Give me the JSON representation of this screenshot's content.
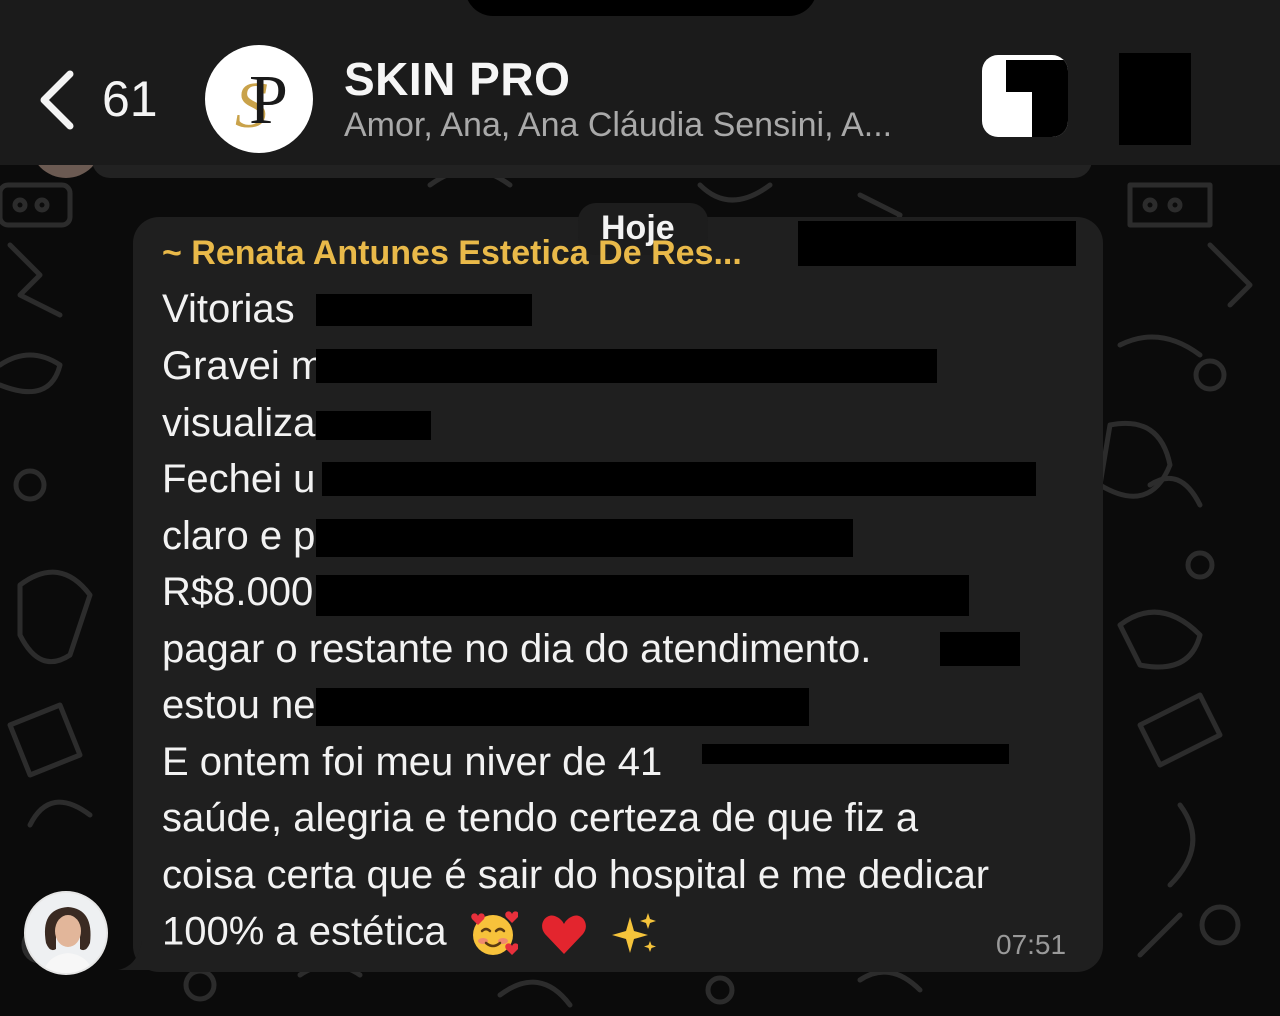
{
  "header": {
    "back_count": "61",
    "title": "SKIN PRO",
    "subtitle": "Amor, Ana, Ana Cláudia Sensini, A..."
  },
  "chat": {
    "date_label": "Hoje",
    "message": {
      "sender": "~ Renata Antunes Estetica De Res...",
      "lines": [
        "Vitorias",
        "Gravei m",
        "visualiza",
        "Fechei u",
        "claro e p",
        "R$8.000",
        "pagar o restante no dia do atendimento.",
        "estou ne",
        "E ontem foi meu niver de 41",
        "saúde, alegria e tendo certeza de que fiz a",
        "coisa certa que é sair do hospital e me dedicar",
        "100% a estética"
      ],
      "time": "07:51"
    }
  },
  "colors": {
    "header_bg": "#1b1b1b",
    "bubble_bg": "#1f1f1f",
    "sender_name": "#e9b949",
    "background": "#0b0b0b"
  },
  "icons": [
    "chevron-left-icon",
    "group-logo",
    "video-call-icon",
    "call-icon",
    "smiling-face-with-hearts-emoji",
    "red-heart-emoji",
    "sparkles-emoji"
  ]
}
